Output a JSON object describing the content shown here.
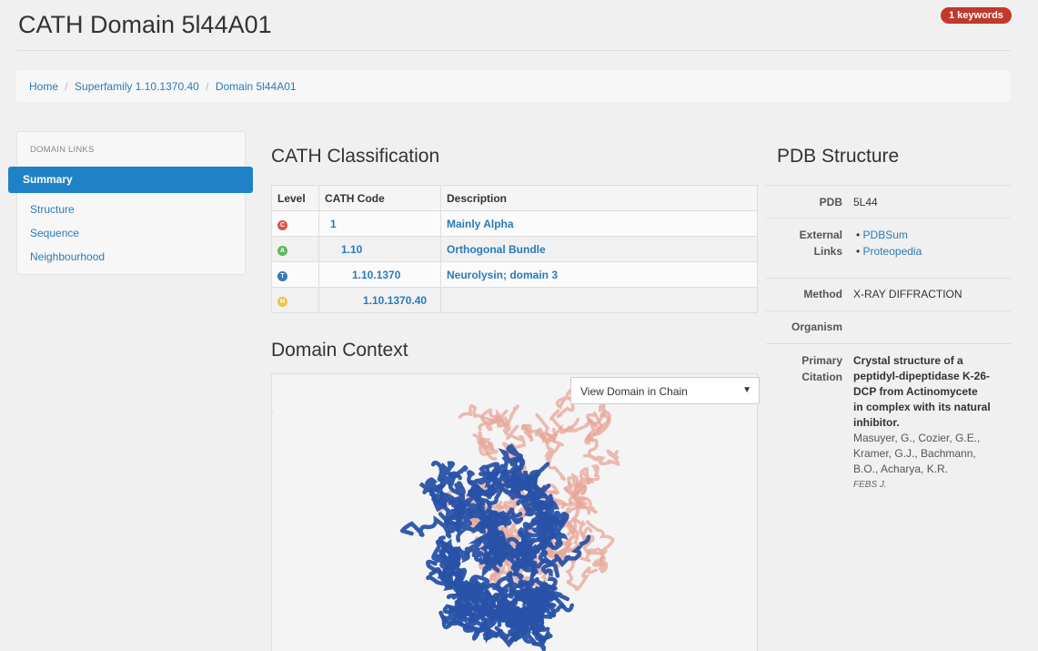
{
  "header": {
    "title": "CATH Domain 5l44A01",
    "keywords_badge": "1 keywords"
  },
  "breadcrumb": {
    "home": "Home",
    "superfamily": "Superfamily 1.10.1370.40",
    "domain": "Domain 5l44A01",
    "separator": "/"
  },
  "sidebar": {
    "header": "DOMAIN LINKS",
    "items": [
      {
        "label": "Summary",
        "active": true
      },
      {
        "label": "Structure"
      },
      {
        "label": "Sequence"
      },
      {
        "label": "Neighbourhood"
      }
    ]
  },
  "classification": {
    "title": "CATH Classification",
    "columns": [
      "Level",
      "CATH Code",
      "Description"
    ],
    "rows": [
      {
        "icon": "class-C-icon",
        "icon_letter": "C",
        "icon_color": "#d9534f",
        "code": "1",
        "description": "Mainly Alpha"
      },
      {
        "icon": "architecture-A-icon",
        "icon_letter": "A",
        "icon_color": "#5cb85c",
        "code": "1.10",
        "description": "Orthogonal Bundle"
      },
      {
        "icon": "topology-T-icon",
        "icon_letter": "T",
        "icon_color": "#337ab7",
        "code": "1.10.1370",
        "description": "Neurolysin; domain 3"
      },
      {
        "icon": "homology-H-icon",
        "icon_letter": "H",
        "icon_color": "#e8c547",
        "code": "1.10.1370.40",
        "description": ""
      }
    ]
  },
  "context": {
    "title": "Domain Context",
    "select_value": "View Domain in Chain",
    "domain_color": "#2852a8",
    "chain_color": "#e8a598"
  },
  "pdb": {
    "title": "PDB Structure",
    "pdb_label": "PDB",
    "pdb_value": "5L44",
    "links_label_1": "External",
    "links_label_2": "Links",
    "links": [
      "PDBSum",
      "Proteopedia"
    ],
    "method_label": "Method",
    "method_value": "X-RAY DIFFRACTION",
    "organism_label": "Organism",
    "organism_value": "",
    "citation_label_1": "Primary",
    "citation_label_2": "Citation",
    "citation_title_lines": [
      "Crystal structure of a",
      "peptidyl-dipeptidase K-26-",
      "DCP from Actinomycete",
      "in complex with its natural",
      "inhibitor."
    ],
    "citation_author_lines": [
      "Masuyer, G., Cozier, G.E.,",
      "Kramer, G.J., Bachmann,",
      "B.O., Acharya, K.R."
    ],
    "citation_journal": "FEBS J."
  }
}
